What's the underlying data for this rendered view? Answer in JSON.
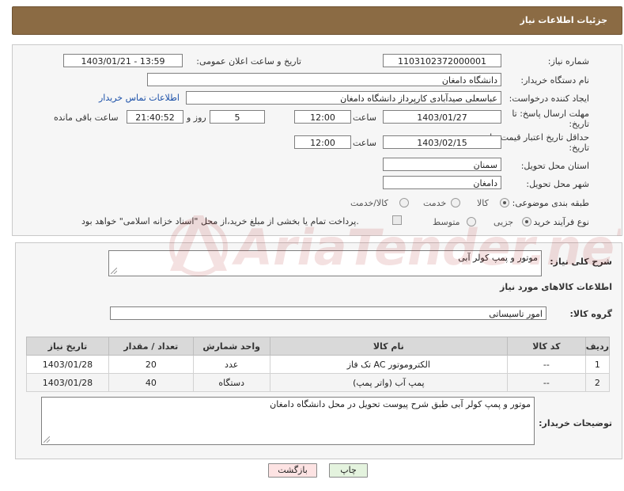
{
  "header": {
    "title": "جزئیات اطلاعات نیاز"
  },
  "form": {
    "need_number": {
      "label": "شماره نیاز:",
      "value": "1103102372000001"
    },
    "announce": {
      "label": "تاریخ و ساعت اعلان عمومی:",
      "value": "1403/01/21 - 13:59"
    },
    "buyer_org": {
      "label": "نام دستگاه خریدار:",
      "value": "دانشگاه دامغان"
    },
    "requester": {
      "label": "ایجاد کننده درخواست:",
      "value": "عباسعلی صیدآبادی کارپرداز دانشگاه دامغان",
      "contact_link": "اطلاعات تماس خریدار"
    },
    "reply_deadline": {
      "label_line1": "مهلت ارسال پاسخ: تا",
      "label_line2": "تاریخ:",
      "date": "1403/01/27",
      "time_label": "ساعت",
      "time": "12:00",
      "days": "5",
      "days_label": "روز و",
      "remaining": "21:40:52",
      "remaining_label": "ساعت باقی مانده"
    },
    "price_deadline": {
      "label_line1": "حداقل تاریخ اعتبار قیمت: تا",
      "label_line2": "تاریخ:",
      "date": "1403/02/15",
      "time_label": "ساعت",
      "time": "12:00"
    },
    "province": {
      "label": "استان محل تحویل:",
      "value": "سمنان"
    },
    "city": {
      "label": "شهر محل تحویل:",
      "value": "دامغان"
    },
    "category": {
      "label": "طبقه بندی موضوعی:",
      "options": [
        "کالا",
        "خدمت",
        "کالا/خدمت"
      ],
      "selected": "کالا"
    },
    "process": {
      "label": "نوع فرآیند خرید :",
      "options": [
        "جزیی",
        "متوسط"
      ],
      "selected": "جزیی",
      "payment_note": "پرداخت تمام یا بخشی از مبلغ خرید،از محل \"اسناد خزانه اسلامی\" خواهد بود."
    }
  },
  "details": {
    "summary_label": "شرح کلی نیاز:",
    "summary_value": "موتور و پمپ کولر آبی",
    "goods_info_title": "اطلاعات کالاهای مورد نیاز",
    "goods_group_label": "گروه کالا:",
    "goods_group_value": "امور تاسیساتی",
    "table": {
      "headers": [
        "ردیف",
        "کد کالا",
        "نام کالا",
        "واحد شمارش",
        "تعداد / مقدار",
        "تاریخ نیاز"
      ],
      "rows": [
        [
          "1",
          "--",
          "الکتروموتور AC تک فاز",
          "عدد",
          "20",
          "1403/01/28"
        ],
        [
          "2",
          "--",
          "پمپ آب (واتر پمپ)",
          "دستگاه",
          "40",
          "1403/01/28"
        ]
      ]
    },
    "buyer_notes_label": "توضیحات خریدار:",
    "buyer_notes_value": "موتور و پمپ کولر آبی طبق شرح پیوست تحویل در محل دانشگاه دامغان"
  },
  "buttons": {
    "print": "چاپ",
    "back": "بازگشت"
  },
  "watermark": {
    "text": "AriaTender.neT"
  },
  "colors": {
    "header_bg": "#8b6b44",
    "link": "#1a4fa8",
    "back_btn_bg": "#fde3e3",
    "print_btn_bg": "#e4f3de"
  }
}
